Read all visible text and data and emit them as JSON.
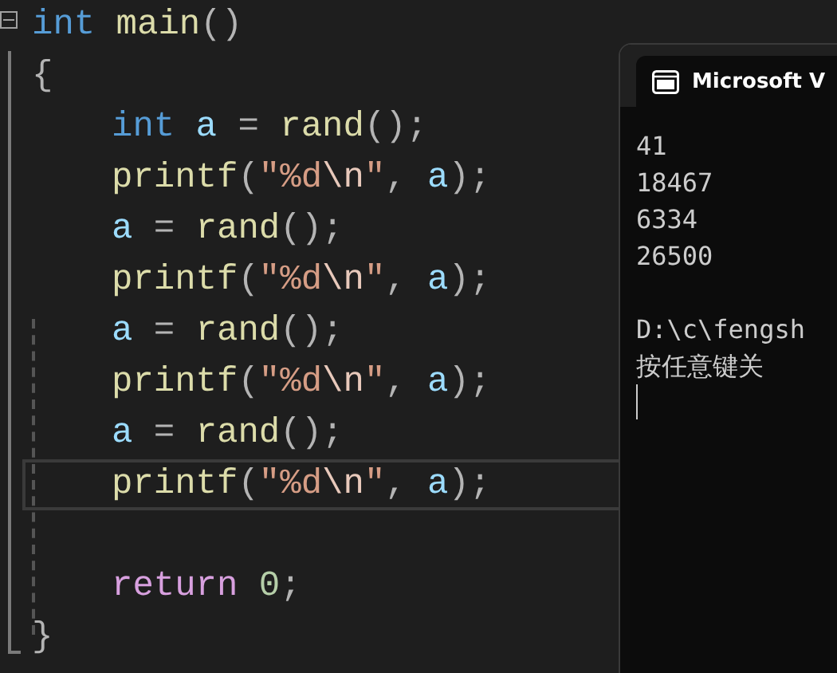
{
  "editor": {
    "lines": [
      {
        "fold": true,
        "current": false,
        "tokens": [
          {
            "text": "int",
            "kind": "keyword"
          },
          {
            "text": " main",
            "kind": "function"
          },
          {
            "text": "()",
            "kind": "punct"
          }
        ]
      },
      {
        "fold": false,
        "current": false,
        "tokens": [
          {
            "text": "{",
            "kind": "punct"
          }
        ],
        "children": [
          {
            "current": false,
            "tokens": [
              {
                "text": "int",
                "kind": "keyword"
              },
              {
                "text": " a",
                "kind": "var"
              },
              {
                "text": " = ",
                "kind": "punct"
              },
              {
                "text": "rand",
                "kind": "function"
              },
              {
                "text": "();",
                "kind": "punct"
              }
            ]
          },
          {
            "current": false,
            "tokens": [
              {
                "text": "printf",
                "kind": "function"
              },
              {
                "text": "(",
                "kind": "punct"
              },
              {
                "text": "\"%d",
                "kind": "string"
              },
              {
                "text": "\\n",
                "kind": "escape"
              },
              {
                "text": "\"",
                "kind": "string"
              },
              {
                "text": ", ",
                "kind": "punct"
              },
              {
                "text": "a",
                "kind": "var"
              },
              {
                "text": ");",
                "kind": "punct"
              }
            ]
          },
          {
            "current": false,
            "tokens": [
              {
                "text": "a",
                "kind": "var"
              },
              {
                "text": " = ",
                "kind": "punct"
              },
              {
                "text": "rand",
                "kind": "function"
              },
              {
                "text": "();",
                "kind": "punct"
              }
            ]
          },
          {
            "current": false,
            "tokens": [
              {
                "text": "printf",
                "kind": "function"
              },
              {
                "text": "(",
                "kind": "punct"
              },
              {
                "text": "\"%d",
                "kind": "string"
              },
              {
                "text": "\\n",
                "kind": "escape"
              },
              {
                "text": "\"",
                "kind": "string"
              },
              {
                "text": ", ",
                "kind": "punct"
              },
              {
                "text": "a",
                "kind": "var"
              },
              {
                "text": ");",
                "kind": "punct"
              }
            ]
          },
          {
            "current": false,
            "tokens": [
              {
                "text": "a",
                "kind": "var"
              },
              {
                "text": " = ",
                "kind": "punct"
              },
              {
                "text": "rand",
                "kind": "function"
              },
              {
                "text": "();",
                "kind": "punct"
              }
            ]
          },
          {
            "current": false,
            "tokens": [
              {
                "text": "printf",
                "kind": "function"
              },
              {
                "text": "(",
                "kind": "punct"
              },
              {
                "text": "\"%d",
                "kind": "string"
              },
              {
                "text": "\\n",
                "kind": "escape"
              },
              {
                "text": "\"",
                "kind": "string"
              },
              {
                "text": ", ",
                "kind": "punct"
              },
              {
                "text": "a",
                "kind": "var"
              },
              {
                "text": ");",
                "kind": "punct"
              }
            ]
          },
          {
            "current": false,
            "tokens": [
              {
                "text": "a",
                "kind": "var"
              },
              {
                "text": " = ",
                "kind": "punct"
              },
              {
                "text": "rand",
                "kind": "function"
              },
              {
                "text": "();",
                "kind": "punct"
              }
            ]
          },
          {
            "current": true,
            "tokens": [
              {
                "text": "printf",
                "kind": "function"
              },
              {
                "text": "(",
                "kind": "punct"
              },
              {
                "text": "\"%d",
                "kind": "string"
              },
              {
                "text": "\\n",
                "kind": "escape"
              },
              {
                "text": "\"",
                "kind": "string"
              },
              {
                "text": ", ",
                "kind": "punct"
              },
              {
                "text": "a",
                "kind": "var"
              },
              {
                "text": ");",
                "kind": "punct"
              }
            ]
          },
          {
            "current": false,
            "gap_before": true,
            "tokens": [
              {
                "text": "return ",
                "kind": "control"
              },
              {
                "text": "0",
                "kind": "number"
              },
              {
                "text": ";",
                "kind": "punct"
              }
            ]
          }
        ]
      },
      {
        "fold": false,
        "current": false,
        "tokens": [
          {
            "text": "}",
            "kind": "punct"
          }
        ]
      }
    ]
  },
  "console": {
    "title": "Microsoft V",
    "lines": [
      {
        "text": "41"
      },
      {
        "text": "18467"
      },
      {
        "text": "6334"
      },
      {
        "text": "26500"
      },
      {
        "text": "D:\\c\\fengsh",
        "gap_before": true
      },
      {
        "text": "按任意键关"
      }
    ]
  }
}
